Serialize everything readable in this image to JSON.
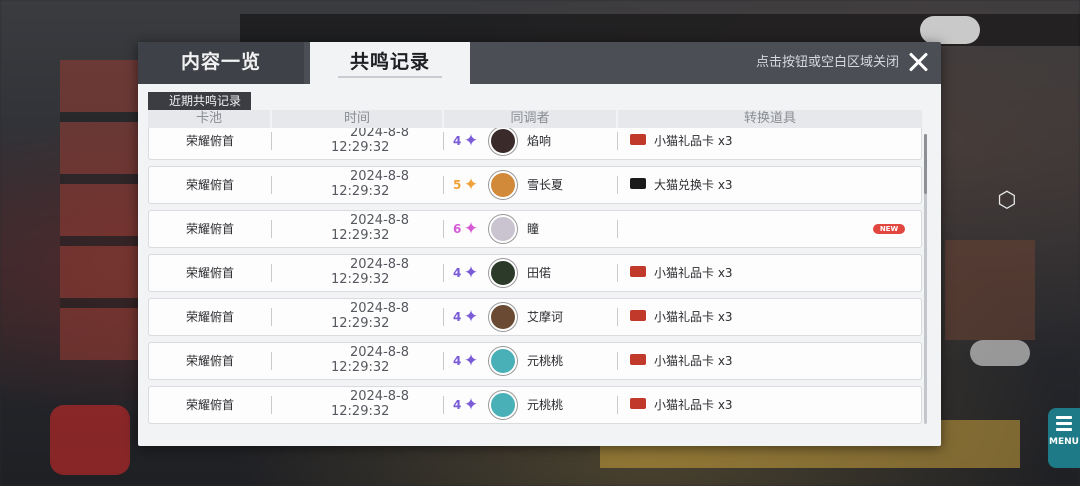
{
  "colors": {
    "rarity4": "#7a5cd6",
    "rarity5": "#f0a23a",
    "rarity6": "#d65bd6",
    "red_card": "#c0392b",
    "gold_card": "#1a1a1a",
    "new_badge": "#e2473f"
  },
  "modal": {
    "tabs": [
      {
        "label": "内容一览",
        "active": false
      },
      {
        "label": "共鸣记录",
        "active": true
      }
    ],
    "close_hint": "点击按钮或空白区域关闭",
    "section_label": "近期共鸣记录",
    "columns": [
      "卡池",
      "时间",
      "同调者",
      "转换道具"
    ],
    "rows": [
      {
        "pool": "荣耀俯首",
        "date": "2024-8-8",
        "time": "12:29:32",
        "rarity": "4",
        "rarity_color": "#7a5cd6",
        "character": "焰响",
        "avatar_icon": "avatar-yanxiang-icon",
        "avatar_color": "#3a2a2a",
        "item": "小猫礼品卡 x3",
        "item_icon": "red-gift-card-icon",
        "item_color": "#c0392b",
        "is_new": false
      },
      {
        "pool": "荣耀俯首",
        "date": "2024-8-8",
        "time": "12:29:32",
        "rarity": "5",
        "rarity_color": "#f0a23a",
        "character": "雪长夏",
        "avatar_icon": "avatar-xuechangxia-icon",
        "avatar_color": "#d08a3a",
        "item": "大猫兑换卡 x3",
        "item_icon": "gold-exchange-card-icon",
        "item_color": "#1a1a1a",
        "is_new": false
      },
      {
        "pool": "荣耀俯首",
        "date": "2024-8-8",
        "time": "12:29:32",
        "rarity": "6",
        "rarity_color": "#d65bd6",
        "character": "瞳",
        "avatar_icon": "avatar-tong-icon",
        "avatar_color": "#c9c4d0",
        "item": "",
        "item_icon": "",
        "item_color": "",
        "is_new": true,
        "new_label": "NEW"
      },
      {
        "pool": "荣耀俯首",
        "date": "2024-8-8",
        "time": "12:29:32",
        "rarity": "4",
        "rarity_color": "#7a5cd6",
        "character": "田偌",
        "avatar_icon": "avatar-tianruo-icon",
        "avatar_color": "#2c3a2a",
        "item": "小猫礼品卡 x3",
        "item_icon": "red-gift-card-icon",
        "item_color": "#c0392b",
        "is_new": false
      },
      {
        "pool": "荣耀俯首",
        "date": "2024-8-8",
        "time": "12:29:32",
        "rarity": "4",
        "rarity_color": "#7a5cd6",
        "character": "艾摩诃",
        "avatar_icon": "avatar-aimohe-icon",
        "avatar_color": "#6a4a32",
        "item": "小猫礼品卡 x3",
        "item_icon": "red-gift-card-icon",
        "item_color": "#c0392b",
        "is_new": false
      },
      {
        "pool": "荣耀俯首",
        "date": "2024-8-8",
        "time": "12:29:32",
        "rarity": "4",
        "rarity_color": "#7a5cd6",
        "character": "元桃桃",
        "avatar_icon": "avatar-yuantaotao-icon",
        "avatar_color": "#4ab0b8",
        "item": "小猫礼品卡 x3",
        "item_icon": "red-gift-card-icon",
        "item_color": "#c0392b",
        "is_new": false
      },
      {
        "pool": "荣耀俯首",
        "date": "2024-8-8",
        "time": "12:29:32",
        "rarity": "4",
        "rarity_color": "#7a5cd6",
        "character": "元桃桃",
        "avatar_icon": "avatar-yuantaotao-icon",
        "avatar_color": "#4ab0b8",
        "item": "小猫礼品卡 x3",
        "item_icon": "red-gift-card-icon",
        "item_color": "#c0392b",
        "is_new": false
      }
    ]
  },
  "menu": {
    "label": "MENU"
  }
}
